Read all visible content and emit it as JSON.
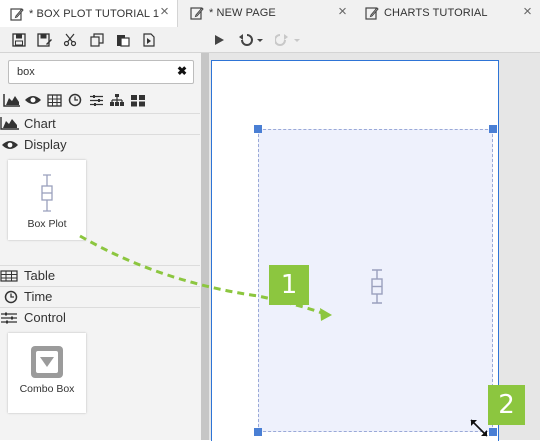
{
  "tabs": [
    {
      "label": "* BOX PLOT TUTORIAL 1"
    },
    {
      "label": "* NEW PAGE"
    },
    {
      "label": "CHARTS TUTORIAL"
    }
  ],
  "search": {
    "value": "box"
  },
  "categories": {
    "chart": "Chart",
    "display": "Display",
    "table": "Table",
    "time": "Time",
    "control": "Control"
  },
  "items": {
    "box_plot": "Box Plot",
    "combo_box": "Combo Box"
  },
  "annotations": {
    "step1": "1",
    "step2": "2"
  },
  "colors": {
    "accent": "#8cc63f",
    "selection": "#4a7fd4",
    "page_border": "#2e74d6",
    "widget_fill": "#eef1fc"
  }
}
